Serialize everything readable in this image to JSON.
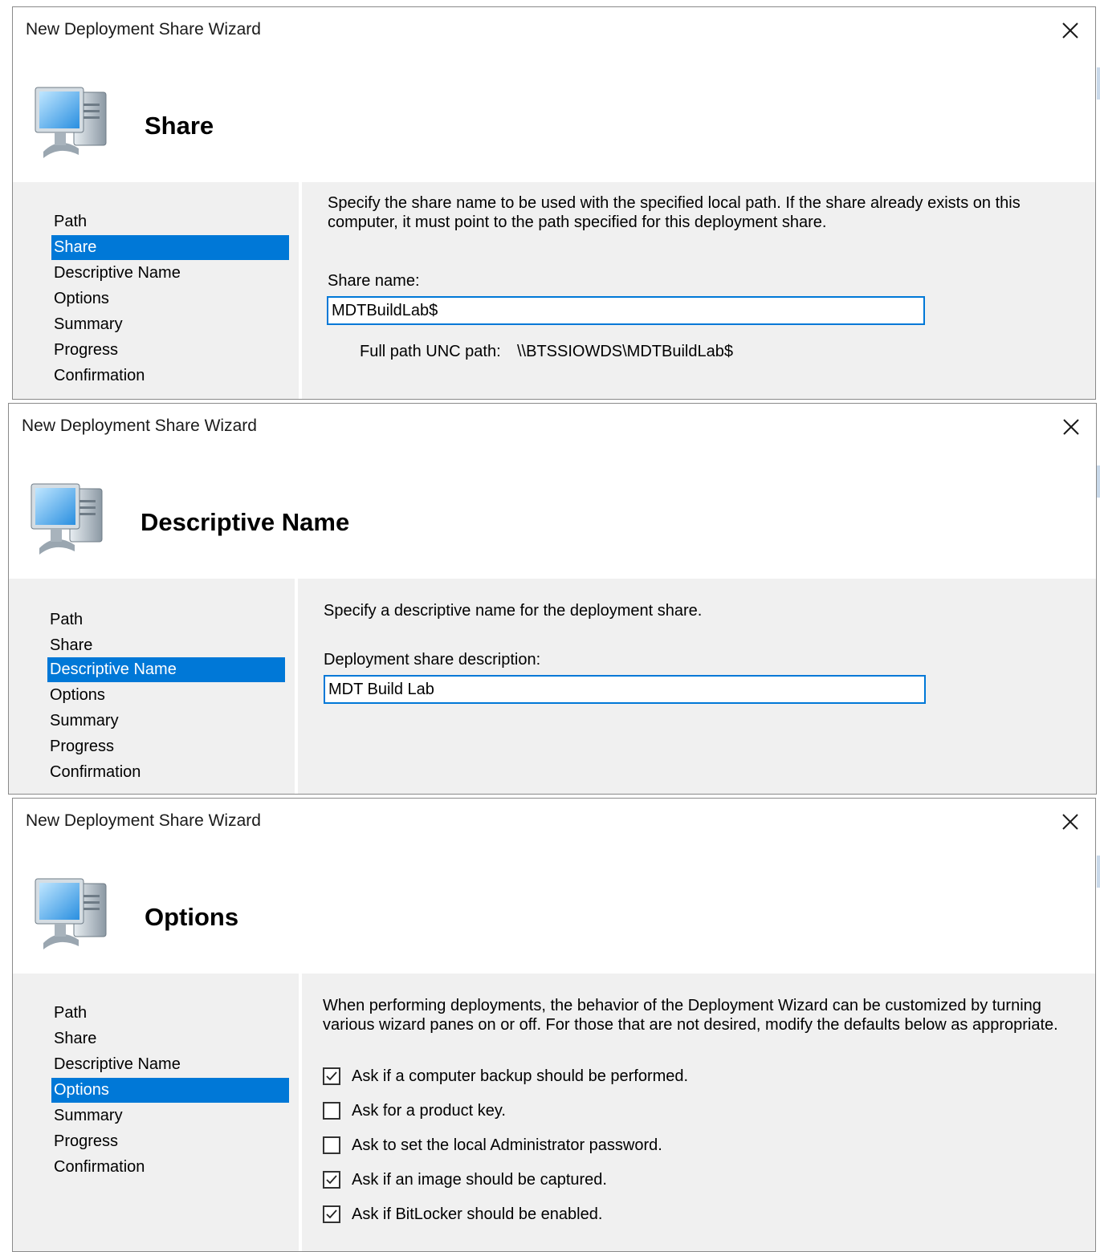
{
  "colors": {
    "selection": "#0078d7",
    "panel_background": "#f0f0f0",
    "input_border": "#0078d7"
  },
  "wizards": [
    {
      "title": "New Deployment Share Wizard",
      "close_icon": "close-icon",
      "header_icon": "computer-icon",
      "page_title": "Share",
      "nav_items": [
        "Path",
        "Share",
        "Descriptive Name",
        "Options",
        "Summary",
        "Progress",
        "Confirmation"
      ],
      "selected_nav": "Share",
      "description": "Specify the share name to be used with the specified local path.  If the share already exists on this computer, it must point to the path specified for this deployment share.",
      "field_label": "Share name:",
      "field_value": "MDTBuildLab$",
      "unc_label": "Full path UNC path:",
      "unc_value": "\\\\BTSSIOWDS\\MDTBuildLab$"
    },
    {
      "title": "New Deployment Share Wizard",
      "close_icon": "close-icon",
      "header_icon": "computer-icon",
      "page_title": "Descriptive Name",
      "nav_items": [
        "Path",
        "Share",
        "Descriptive Name",
        "Options",
        "Summary",
        "Progress",
        "Confirmation"
      ],
      "selected_nav": "Descriptive Name",
      "description": "Specify a descriptive name for the deployment share.",
      "field_label": "Deployment share description:",
      "field_value": "MDT Build Lab"
    },
    {
      "title": "New Deployment Share Wizard",
      "close_icon": "close-icon",
      "header_icon": "computer-icon",
      "page_title": "Options",
      "nav_items": [
        "Path",
        "Share",
        "Descriptive Name",
        "Options",
        "Summary",
        "Progress",
        "Confirmation"
      ],
      "selected_nav": "Options",
      "description": "When performing deployments, the behavior of the Deployment Wizard can be customized by turning various wizard panes on or off.  For those that are not desired, modify the defaults below as appropriate.",
      "options": [
        {
          "label": "Ask if a computer backup should be performed.",
          "checked": true
        },
        {
          "label": "Ask for a product key.",
          "checked": false
        },
        {
          "label": "Ask to set the local Administrator password.",
          "checked": false
        },
        {
          "label": "Ask if an image should be captured.",
          "checked": true
        },
        {
          "label": "Ask if BitLocker should be enabled.",
          "checked": true
        }
      ]
    }
  ]
}
